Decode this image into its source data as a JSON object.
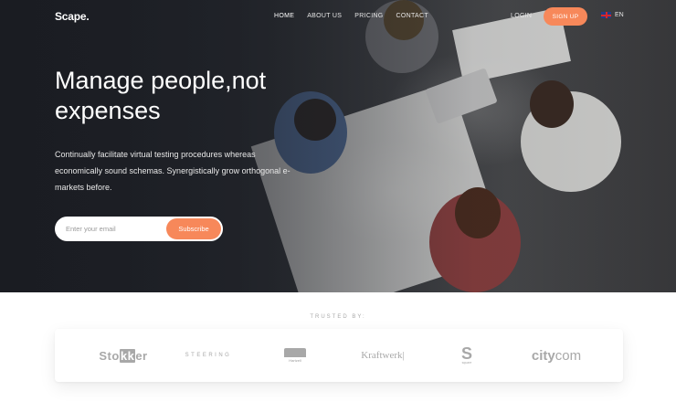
{
  "brand": {
    "logo": "Scape."
  },
  "nav": {
    "items": [
      {
        "label": "HOME",
        "active": true
      },
      {
        "label": "ABOUT US",
        "active": false
      },
      {
        "label": "PRICING",
        "active": false
      },
      {
        "label": "CONTACT",
        "active": false
      }
    ],
    "login": "LOGIN",
    "signup": "SIGN UP",
    "language": "EN",
    "language_flag_icon": "uk-flag-icon"
  },
  "hero": {
    "headline_line1": "Manage people,not",
    "headline_line2": "expenses",
    "description": "Continually facilitate virtual testing procedures whereas economically sound schemas. Synergistically grow orthogonal e-markets before.",
    "email_placeholder": "Enter your email",
    "subscribe": "Subscribe"
  },
  "trusted": {
    "label": "TRUSTED BY:",
    "logos": {
      "stokker_pre": "Sto",
      "stokker_kk": "kk",
      "stokker_post": "er",
      "steering": "STEERING",
      "hartzell": "Hartzell",
      "kraftwerk": "Kraftwerk|",
      "square_mark": "S",
      "square": "square",
      "city_bold": "city",
      "city_rest": "com"
    }
  },
  "colors": {
    "accent": "#f7885a",
    "hero_dark": "#23252b",
    "logo_gray": "#a8a8a8"
  }
}
